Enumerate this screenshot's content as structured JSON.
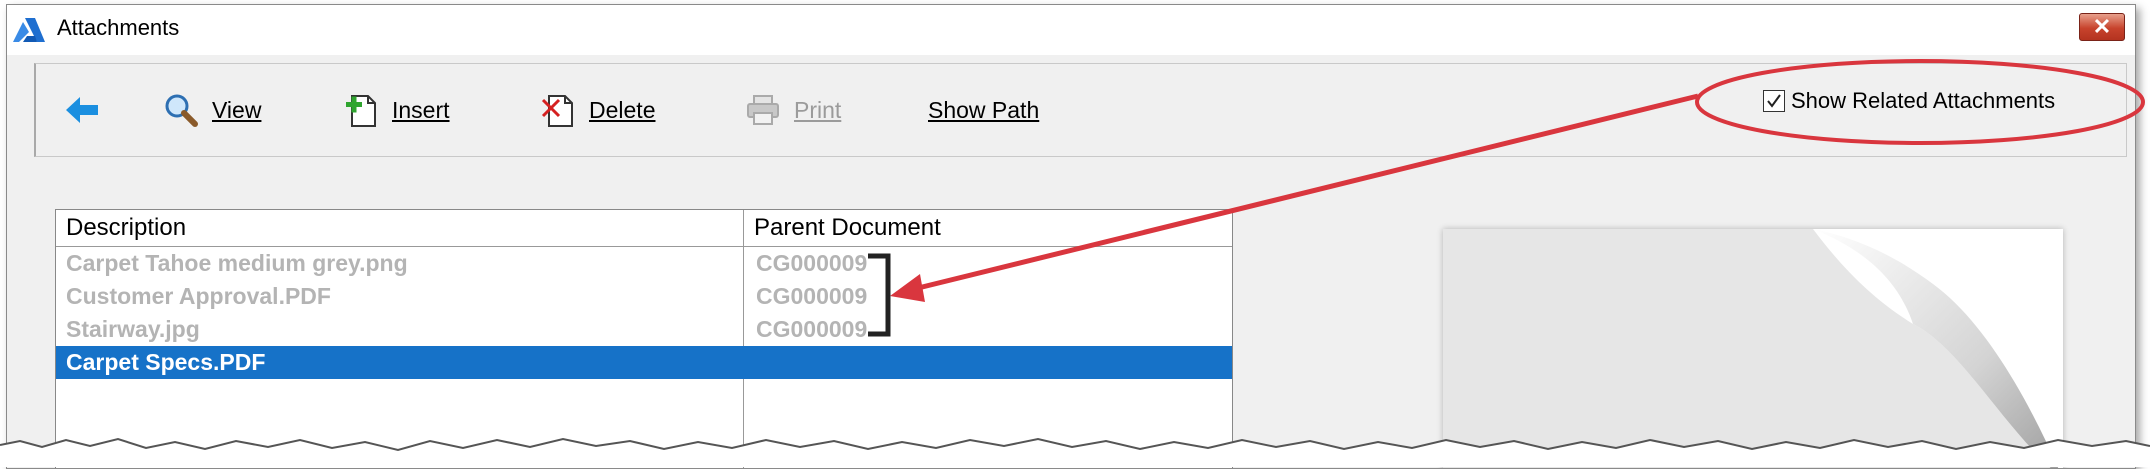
{
  "window": {
    "title": "Attachments",
    "close_glyph": "✕"
  },
  "toolbar": {
    "back_icon": "back-arrow-icon",
    "view_label": "View",
    "insert_label": "Insert",
    "delete_label": "Delete",
    "print_label": "Print",
    "show_path_label": "Show Path",
    "show_related_label": "Show Related Attachments",
    "show_related_checked": true
  },
  "table": {
    "columns": [
      "Description",
      "Parent Document"
    ],
    "rows": [
      {
        "description": "Carpet Tahoe medium grey.png",
        "parent": "CG000009",
        "state": "related"
      },
      {
        "description": "Customer Approval.PDF",
        "parent": "CG000009",
        "state": "related"
      },
      {
        "description": "Stairway.jpg",
        "parent": "CG000009",
        "state": "related"
      },
      {
        "description": "Carpet Specs.PDF",
        "parent": "",
        "state": "selected"
      }
    ]
  },
  "colors": {
    "selection": "#1672c8",
    "related_text": "#b4b4b4",
    "annotation": "#d9363e"
  }
}
